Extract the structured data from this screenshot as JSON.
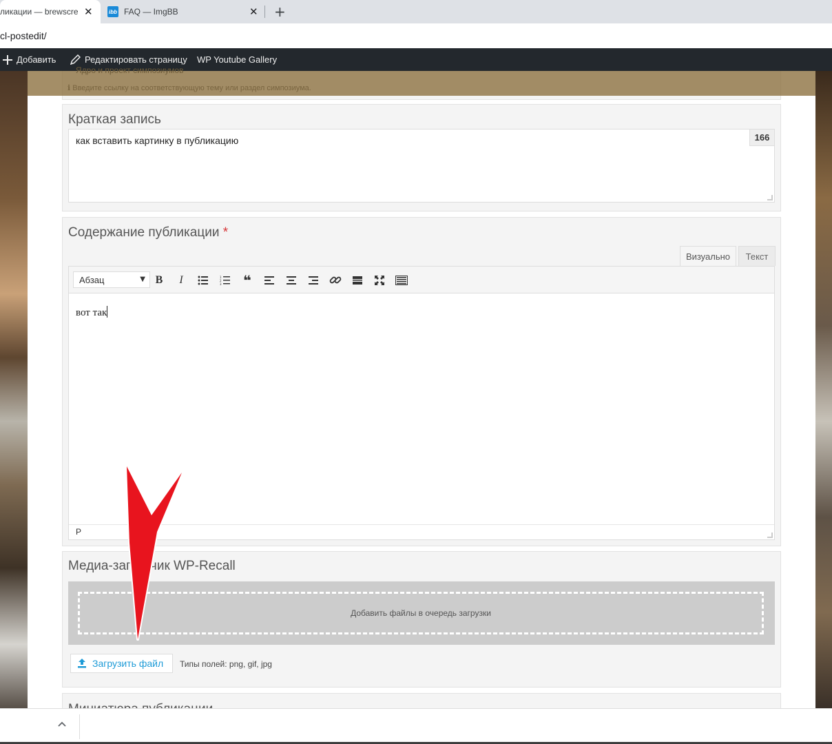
{
  "browser": {
    "tabs": [
      {
        "title": "ликации — brewscre",
        "close": "✕",
        "active": true
      },
      {
        "favicon": "ibb",
        "title": "FAQ — ImgBB",
        "close": "✕",
        "active": false
      }
    ],
    "new_tab": "+",
    "url": "cl-postedit/"
  },
  "adminbar": {
    "add_icon": "plus-icon",
    "add_label": "Добавить",
    "edit_icon": "pencil-icon",
    "edit_label": "Редактировать страницу",
    "gallery_label": "WP Youtube Gallery"
  },
  "faded_header": {
    "line1": "Ядро и проект симпозиумов",
    "line2": "ℹ Введите ссылку на соответствующую тему или раздел симпозиума."
  },
  "excerpt": {
    "label": "Краткая запись",
    "value": "как вставить картинку в публикацию",
    "counter": "166"
  },
  "content": {
    "label": "Содержание публикации",
    "required_mark": "*",
    "tab_visual": "Визуально",
    "tab_text": "Текст",
    "format_value": "Абзац",
    "format_arrow": "▼",
    "body": "вот так",
    "path": "P"
  },
  "media": {
    "label": "Медиа-загрузчик WP-Recall",
    "dropzone_text": "Добавить файлы в очередь загрузки",
    "upload_label": "Загрузить файл",
    "file_types": "Типы полей: png, gif, jpg"
  },
  "thumbnail": {
    "label": "Миниатюра публикации"
  },
  "downloadbar": {
    "chevron": "^"
  },
  "colors": {
    "admin_bar": "#23282d",
    "required": "#d63638",
    "upload_link": "#1e9bd7",
    "annotation_arrow": "#e8141e"
  }
}
